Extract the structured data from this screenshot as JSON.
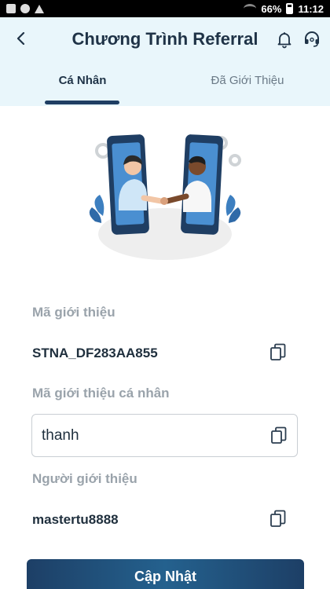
{
  "status_bar": {
    "battery": "66%",
    "time": "11:12"
  },
  "header": {
    "title": "Chương Trình Referral",
    "tabs": [
      {
        "label": "Cá Nhân",
        "active": true
      },
      {
        "label": "Đã Giới Thiệu",
        "active": false
      }
    ]
  },
  "form": {
    "referral_code_label": "Mã giới thiệu",
    "referral_code_value": "STNA_DF283AA855",
    "personal_code_label": "Mã giới thiệu cá nhân",
    "personal_code_value": "thanh",
    "referrer_label": "Người giới thiệu",
    "referrer_value": "mastertu8888"
  },
  "update_button": {
    "label": "Cập Nhật"
  },
  "colors": {
    "header_bg": "#e9f6fb",
    "primary": "#1f3e63",
    "label_gray": "#9aa3ab",
    "accent_blue": "#3d7fc0"
  },
  "icons": [
    "back-arrow-icon",
    "bell-icon",
    "headset-icon",
    "copy-icon",
    "handshake-illustration"
  ]
}
